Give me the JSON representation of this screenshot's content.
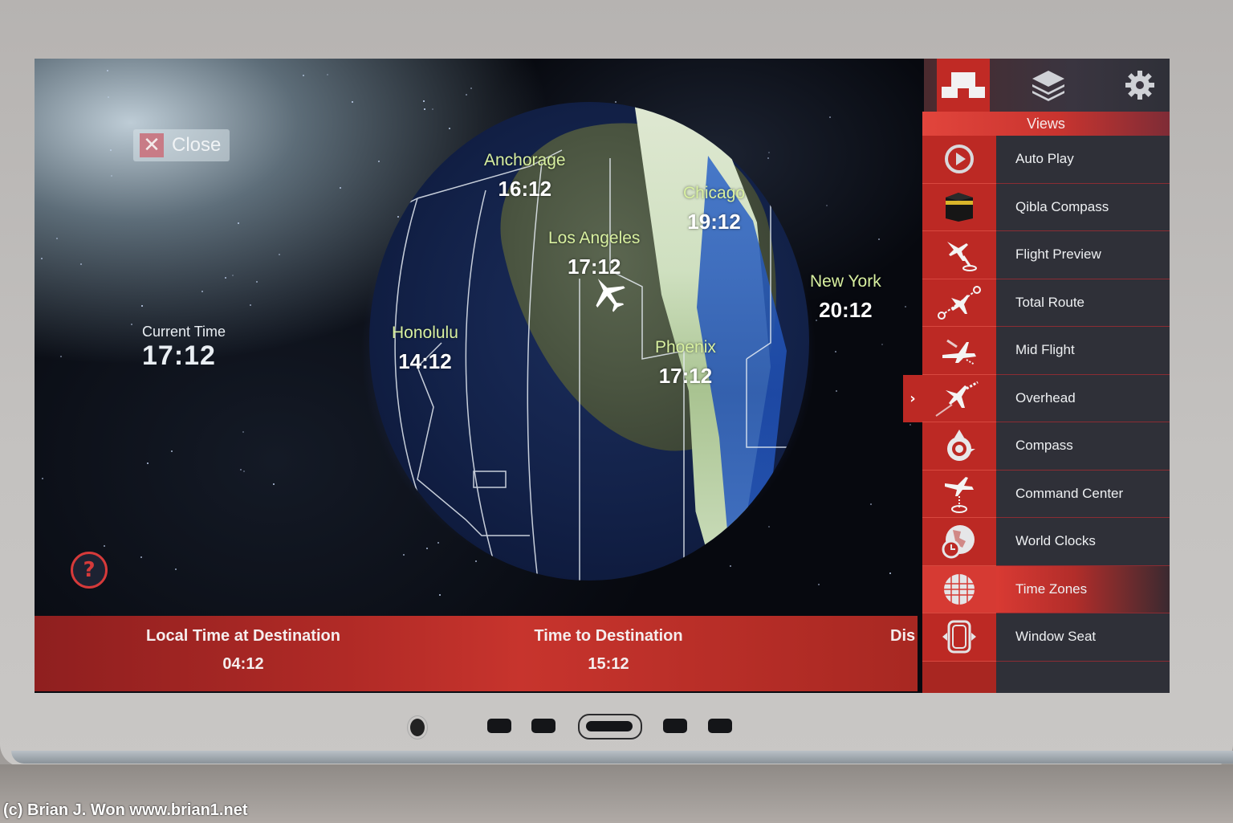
{
  "close_button": {
    "label": "Close"
  },
  "current_time": {
    "label": "Current Time",
    "value": "17:12"
  },
  "help_button": {
    "label": "?"
  },
  "cities": [
    {
      "name": "Anchorage",
      "time": "16:12"
    },
    {
      "name": "Los Angeles",
      "time": "17:12"
    },
    {
      "name": "Chicago",
      "time": "19:12"
    },
    {
      "name": "New York",
      "time": "20:12"
    },
    {
      "name": "Honolulu",
      "time": "14:12"
    },
    {
      "name": "Phoenix",
      "time": "17:12"
    }
  ],
  "bottom_bar": {
    "local_time_label": "Local Time at Destination",
    "local_time_value": "04:12",
    "time_to_dest_label": "Time to Destination",
    "time_to_dest_value": "15:12",
    "distance_label_partial": "Dis"
  },
  "panel": {
    "tabs": [
      {
        "icon": "views-icon",
        "active": true
      },
      {
        "icon": "layers-icon",
        "active": false
      },
      {
        "icon": "gear-icon",
        "active": false
      }
    ],
    "section_title": "Views",
    "items": [
      {
        "label": "Auto Play",
        "icon": "play-circle-icon"
      },
      {
        "label": "Qibla Compass",
        "icon": "kaaba-icon"
      },
      {
        "label": "Flight Preview",
        "icon": "flight-preview-icon"
      },
      {
        "label": "Total Route",
        "icon": "total-route-icon"
      },
      {
        "label": "Mid Flight",
        "icon": "mid-flight-icon"
      },
      {
        "label": "Overhead",
        "icon": "overhead-icon",
        "current": true
      },
      {
        "label": "Compass",
        "icon": "compass-icon"
      },
      {
        "label": "Command Center",
        "icon": "command-center-icon"
      },
      {
        "label": "World Clocks",
        "icon": "world-clocks-icon"
      },
      {
        "label": "Time Zones",
        "icon": "time-zones-icon",
        "selected": true
      },
      {
        "label": "Window Seat",
        "icon": "window-seat-icon"
      }
    ],
    "current_indicator": "›"
  },
  "watermark": "(c) Brian J. Won www.brian1.net"
}
